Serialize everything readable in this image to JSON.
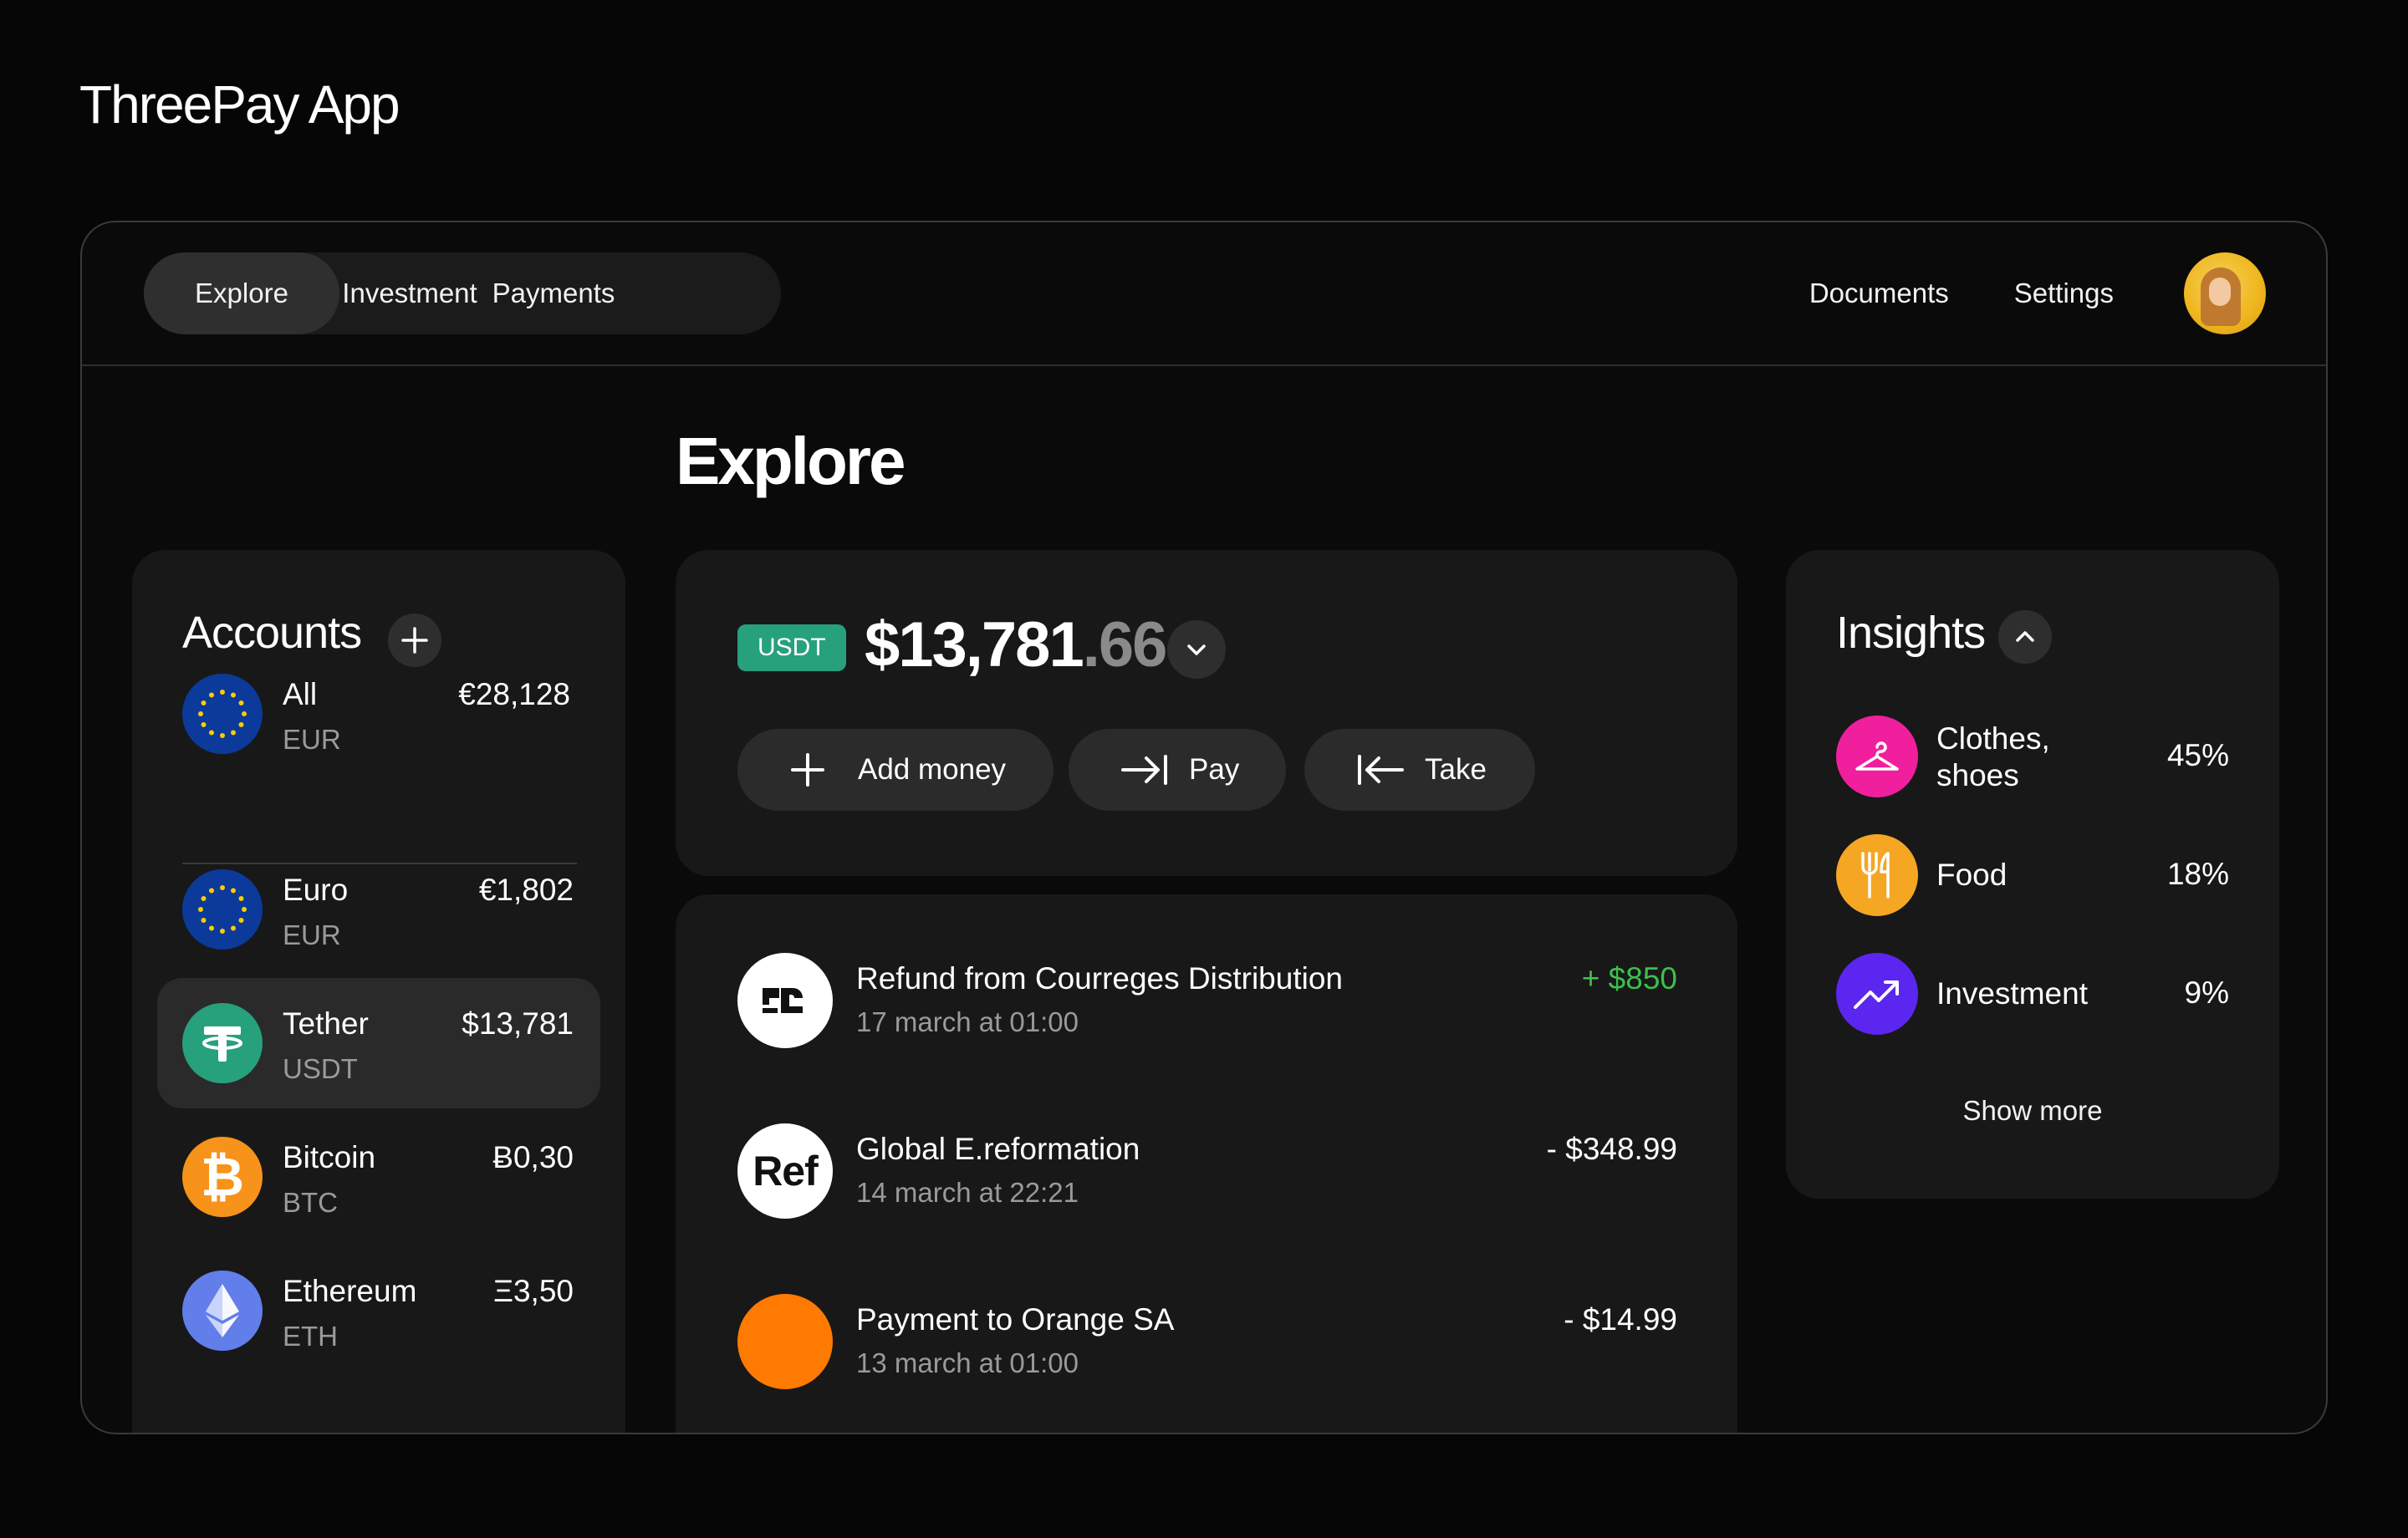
{
  "app_title": "ThreePay App",
  "nav": {
    "tabs": [
      {
        "label": "Explore",
        "active": true
      },
      {
        "label": "Investment",
        "active": false
      },
      {
        "label": "Payments",
        "active": false
      }
    ],
    "links": [
      "Documents",
      "Settings"
    ]
  },
  "page_title": "Explore",
  "accounts": {
    "title": "Accounts",
    "all": {
      "name": "All",
      "code": "EUR",
      "amount": "€28,128",
      "icon": "eu-flag-icon"
    },
    "items": [
      {
        "name": "Euro",
        "code": "EUR",
        "amount": "€1,802",
        "icon": "eu-flag-icon",
        "selected": false
      },
      {
        "name": "Tether",
        "code": "USDT",
        "amount": "$13,781",
        "icon": "tether-icon",
        "selected": true
      },
      {
        "name": "Bitcoin",
        "code": "BTC",
        "amount": "Ƀ0,30",
        "icon": "bitcoin-icon",
        "selected": false
      },
      {
        "name": "Ethereum",
        "code": "ETH",
        "amount": "Ξ3,50",
        "icon": "ethereum-icon",
        "selected": false
      }
    ]
  },
  "balance": {
    "currency_badge": "USDT",
    "amount_main": "$13,781",
    "amount_cents": ".66",
    "actions": [
      {
        "label": "Add money",
        "icon": "plus-icon"
      },
      {
        "label": "Pay",
        "icon": "arrow-right-bar-icon"
      },
      {
        "label": "Take",
        "icon": "arrow-left-bar-icon"
      }
    ]
  },
  "transactions": [
    {
      "title": "Refund from Courreges Distribution",
      "date": "17 march at 01:00",
      "amount": "+ $850",
      "positive": true,
      "logo": "courreges-logo"
    },
    {
      "title": "Global E.reformation",
      "date": "14 march at 22:21",
      "amount": "- $348.99",
      "positive": false,
      "logo": "Ref"
    },
    {
      "title": "Payment to Orange SA",
      "date": "13 march at 01:00",
      "amount": "- $14.99",
      "positive": false,
      "logo": "orange-logo"
    }
  ],
  "insights": {
    "title": "Insights",
    "items": [
      {
        "label": "Clothes, shoes",
        "percent": "45%",
        "icon": "hanger-icon",
        "color": "#f01f9e"
      },
      {
        "label": "Food",
        "percent": "18%",
        "icon": "fork-knife-icon",
        "color": "#f5a623"
      },
      {
        "label": "Investment",
        "percent": "9%",
        "icon": "trend-up-icon",
        "color": "#5b26f0"
      }
    ],
    "show_more": "Show more"
  },
  "colors": {
    "background": "#060606",
    "card": "#181818",
    "tether_green": "#26a17b",
    "bitcoin_orange": "#f7931a",
    "ethereum_blue": "#627eea",
    "eu_blue": "#0b3a9a",
    "positive_green": "#3dbf4d",
    "orange_logo": "#ff7a00"
  }
}
